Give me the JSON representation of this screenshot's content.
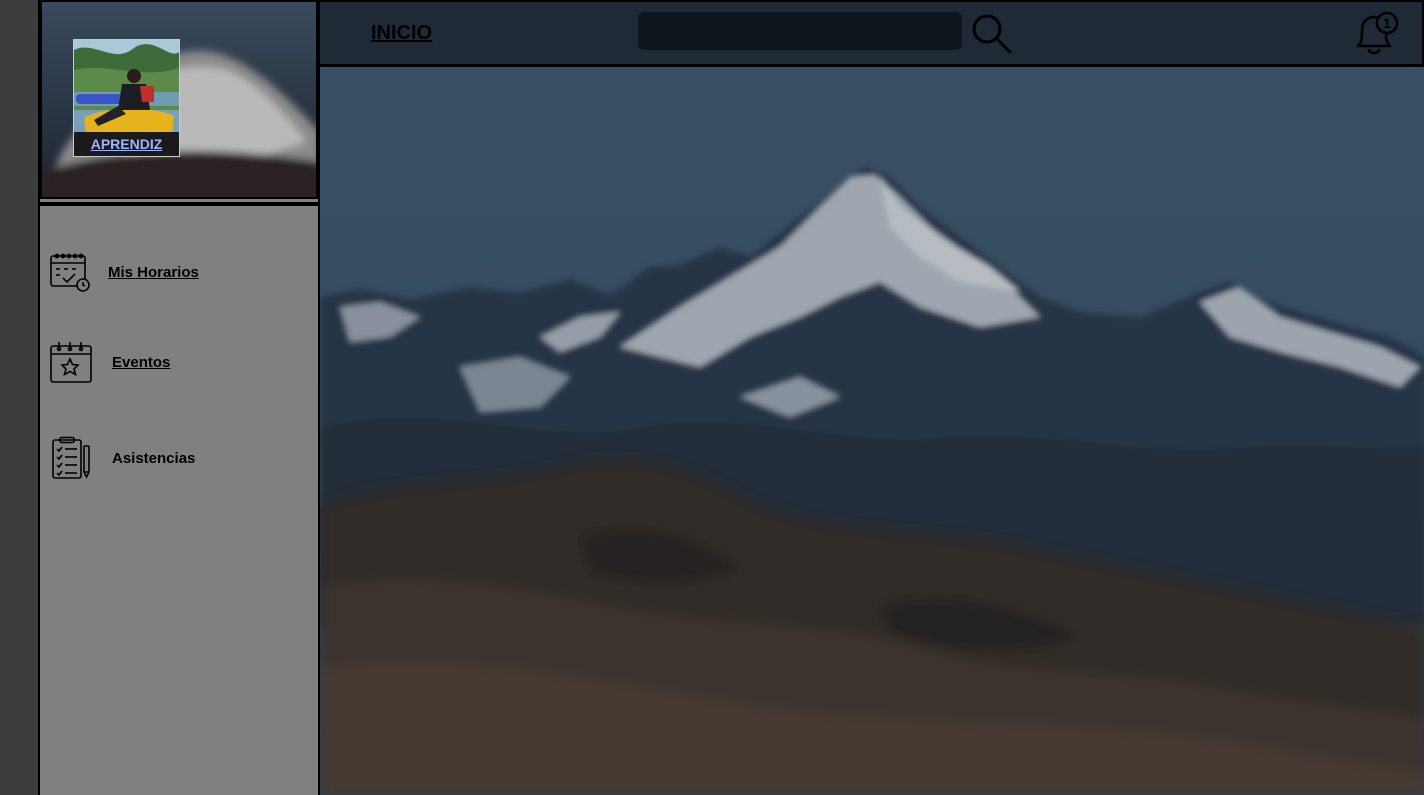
{
  "header": {
    "home_label": "INICIO",
    "search_placeholder": "",
    "search_value": "",
    "notification_count": "1"
  },
  "profile": {
    "role_label": "APRENDIZ"
  },
  "sidebar": {
    "items": [
      {
        "label": "Mis Horarios",
        "icon": "calendar-check-icon",
        "link": true
      },
      {
        "label": "Eventos",
        "icon": "calendar-star-icon",
        "link": true
      },
      {
        "label": "Asistencias",
        "icon": "clipboard-checklist-icon",
        "link": false
      }
    ]
  },
  "colors": {
    "sidebar_bg": "#808080",
    "header_bg": "#1f2a36",
    "search_bg": "#0f151c",
    "role_label": "#9fb4ff"
  }
}
